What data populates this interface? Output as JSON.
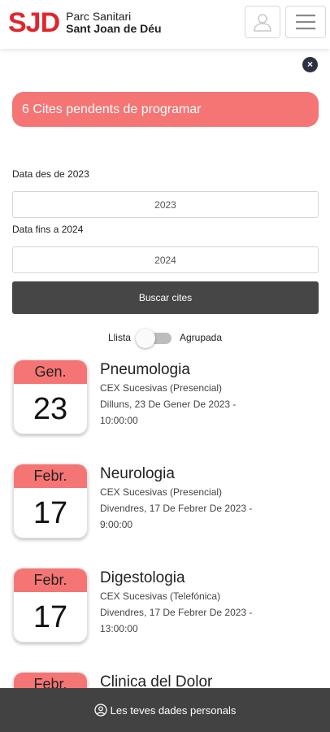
{
  "header": {
    "logo_mark": "SJD",
    "logo_line1": "Parc Sanitari",
    "logo_line2": "Sant Joan de Déu",
    "user_icon": "user-icon",
    "menu_icon": "hamburger-menu-icon"
  },
  "close_label": "×",
  "pending_banner": "6 Cites pendents de programar",
  "filters": {
    "from_label": "Data des de 2023",
    "from_value": "2023",
    "to_label": "Data fins a 2024",
    "to_value": "2024",
    "search_label": "Buscar cites"
  },
  "view_toggle": {
    "left_label": "Llista",
    "right_label": "Agrupada",
    "state": "off"
  },
  "appointments": [
    {
      "month": "Gen.",
      "day": "23",
      "specialty": "Pneumologia",
      "type": "CEX Sucesivas (Presencial)",
      "date": "Dilluns, 23 De Gener De 2023 -",
      "time": "10:00:00"
    },
    {
      "month": "Febr.",
      "day": "17",
      "specialty": "Neurologia",
      "type": "CEX Sucesivas (Presencial)",
      "date": "Divendres, 17 De Febrer De 2023 -",
      "time": "9:00:00"
    },
    {
      "month": "Febr.",
      "day": "17",
      "specialty": "Digestologia",
      "type": "CEX Sucesivas (Telefónica)",
      "date": "Divendres, 17 De Febrer De 2023 -",
      "time": "13:00:00"
    },
    {
      "month": "Febr.",
      "day": "",
      "specialty": "Clinica del Dolor",
      "type": "",
      "date": "",
      "time": ""
    }
  ],
  "footer": {
    "icon": "user-circle-icon",
    "label": "Les teves dades personals"
  },
  "colors": {
    "brand_red": "#e0262d",
    "banner": "#f57575",
    "button_dark": "#464646",
    "footer": "#424242"
  }
}
